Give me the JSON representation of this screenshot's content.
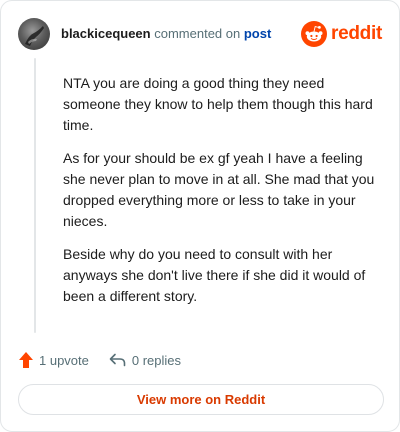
{
  "header": {
    "username": "blackicequeen",
    "commented_text": "commented on",
    "post_link": "post",
    "brand_name": "reddit"
  },
  "comment": {
    "paragraphs": [
      "NTA you are doing a good thing they need someone they know to help them though this hard time.",
      "As for your should be ex gf yeah I have a feeling she never plan to move in at all. She mad that you dropped everything more or less to take in your nieces.",
      "Beside why do you need to consult with her anyways she don't live there if she did it would of been a different story."
    ]
  },
  "actions": {
    "upvote_label": "1 upvote",
    "reply_label": "0 replies"
  },
  "footer": {
    "view_more_label": "View more on Reddit"
  },
  "icons": {
    "avatar": "user-avatar",
    "brand": "reddit-logo-icon",
    "upvote": "upvote-arrow-icon",
    "reply": "reply-arrow-icon"
  },
  "colors": {
    "brand": "#ff4500",
    "link": "#0045ac",
    "upvote": "#ff4500",
    "view_more_text": "#d93a00",
    "muted_text": "#576f76",
    "border": "#e3e6e8"
  }
}
